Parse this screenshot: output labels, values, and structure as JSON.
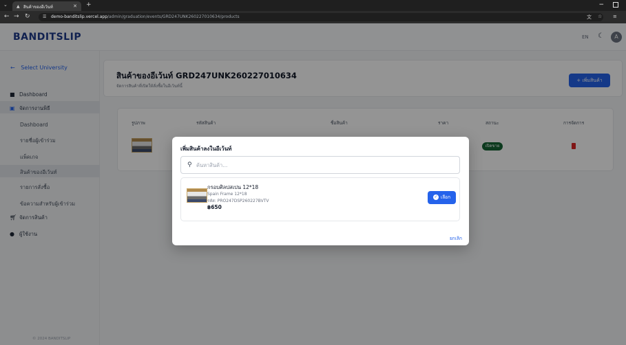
{
  "browser": {
    "tab_title": "สินค้าของอีเว้นท์",
    "url_site": "demo-banditslip.vercel.app",
    "url_path": "/admin/graduation/events/GRD247UNK260227010634/products",
    "new_tab_label": "+",
    "minimize_label": "−"
  },
  "header": {
    "logo": "BANDITSLIP",
    "lang": "EN",
    "avatar_initial": "A"
  },
  "sidebar": {
    "back_label": "Select University",
    "items": [
      {
        "label": "Dashboard",
        "icon": "grid-icon"
      },
      {
        "label": "จัดการงานพิธี",
        "icon": "calendar-icon"
      },
      {
        "label": "Dashboard"
      },
      {
        "label": "รายชื่อผู้เข้าร่วม"
      },
      {
        "label": "แพ็คเกจ"
      },
      {
        "label": "สินค้าของอีเว้นท์"
      },
      {
        "label": "รายการสั่งซื้อ"
      },
      {
        "label": "ข้อความสำหรับผู้เข้าร่วม"
      },
      {
        "label": "จัดการสินค้า",
        "icon": "cart-icon"
      },
      {
        "label": "ผู้ใช้งาน",
        "icon": "users-icon"
      }
    ],
    "footer": "© 2024 BANDITSLIP"
  },
  "page": {
    "title": "สินค้าของอีเว้นท์ GRD247UNK260227010634",
    "subtitle": "จัดการสินค้าที่เปิดให้สั่งซื้อในอีเว้นท์นี้",
    "add_button": "+ เพิ่มสินค้า",
    "table_headers": [
      "รูปภาพ",
      "รหัสสินค้า",
      "ชื่อสินค้า",
      "ราคา",
      "สถานะ",
      "การจัดการ"
    ],
    "row_status": "เปิดขาย"
  },
  "modal": {
    "title": "เพิ่มสินค้าลงในอีเว้นท์",
    "search_placeholder": "ค้นหาสินค้า...",
    "search_value": "",
    "product": {
      "name": "กรอบศิลปสเปน 12*18",
      "name_en": "Spain Frame 12*18",
      "code": "รหัส: PRO247DSP260227BVTV",
      "price": "฿650"
    },
    "select_label": "เลือก",
    "cancel_label": "ยกเลิก"
  },
  "colors": {
    "brand": "#1e3a8a",
    "primary": "#2563eb",
    "status_green": "#166534",
    "danger": "#dc2626"
  }
}
